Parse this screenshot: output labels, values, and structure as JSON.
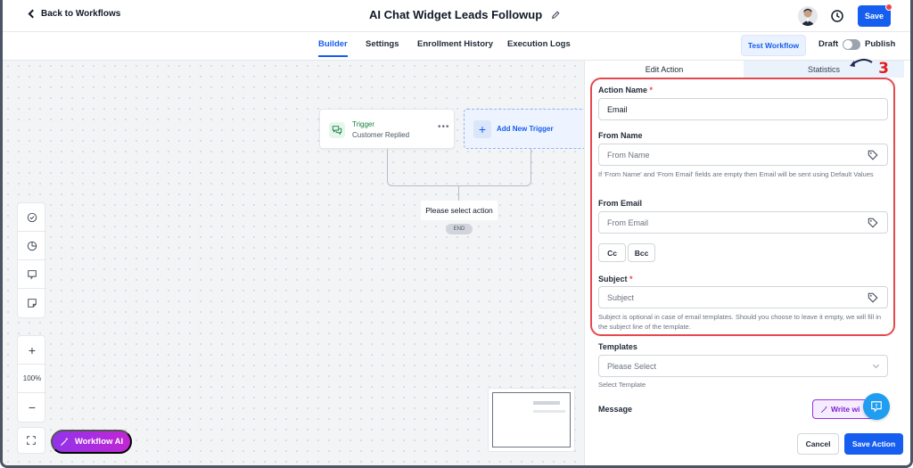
{
  "header": {
    "back_label": "Back to Workflows",
    "title": "AI Chat Widget Leads Followup",
    "save_label": "Save"
  },
  "tabs": [
    {
      "label": "Builder",
      "active": true
    },
    {
      "label": "Settings"
    },
    {
      "label": "Enrollment History"
    },
    {
      "label": "Execution Logs"
    }
  ],
  "test_workflow_label": "Test Workflow",
  "draft_label": "Draft",
  "publish_label": "Publish",
  "canvas": {
    "trigger_title": "Trigger",
    "trigger_sub": "Customer Replied",
    "trigger_menu": "•••",
    "add_trigger_label": "Add New Trigger",
    "select_action_label": "Please select action",
    "end_label": "END",
    "zoom_level": "100%",
    "workflow_ai_label": "Workflow AI",
    "zoom_in": "+",
    "zoom_out": "−"
  },
  "panel": {
    "tab_edit": "Edit Action",
    "tab_stats": "Statistics",
    "action_name_label": "Action Name",
    "action_name_value": "Email",
    "from_name_label": "From Name",
    "from_name_placeholder": "From Name",
    "from_name_hint": "If 'From Name' and 'From Email' fields are empty then Email will be sent using Default Values",
    "from_email_label": "From Email",
    "from_email_placeholder": "From Email",
    "cc_label": "Cc",
    "bcc_label": "Bcc",
    "subject_label": "Subject",
    "subject_placeholder": "Subject",
    "subject_hint": "Subject is optional in case of email templates. Should you choose to leave it empty, we will fill in the subject line of the template.",
    "templates_label": "Templates",
    "templates_placeholder": "Please Select",
    "templates_hint": "Select Template",
    "message_label": "Message",
    "write_with_ai_label": "Write wi",
    "cancel_label": "Cancel",
    "save_action_label": "Save Action",
    "required_mark": "*"
  },
  "annotation": {
    "number": "3"
  },
  "colors": {
    "primary": "#155eef",
    "highlight": "#e5484d",
    "ai_gradient": "#9333ea",
    "trigger_green": "#15803d"
  }
}
